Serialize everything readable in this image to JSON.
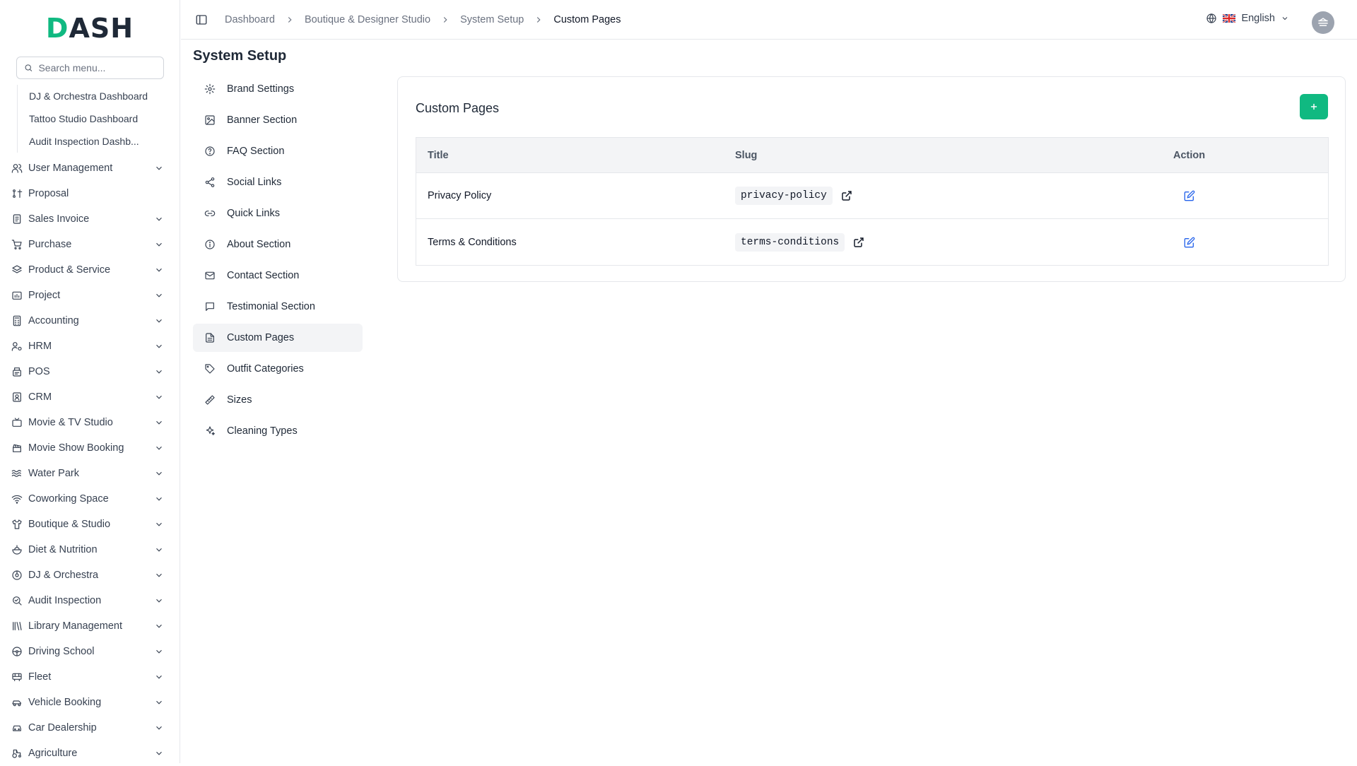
{
  "app": {
    "logo_text": "DASH"
  },
  "sidebar": {
    "search_placeholder": "Search menu...",
    "sub_items": [
      "DJ & Orchestra Dashboard",
      "Tattoo Studio Dashboard",
      "Audit Inspection Dashb..."
    ],
    "items": [
      {
        "label": "User Management",
        "icon": "users-icon",
        "chevron": true
      },
      {
        "label": "Proposal",
        "icon": "proposal-icon",
        "chevron": false
      },
      {
        "label": "Sales Invoice",
        "icon": "invoice-icon",
        "chevron": true
      },
      {
        "label": "Purchase",
        "icon": "cart-icon",
        "chevron": true
      },
      {
        "label": "Product & Service",
        "icon": "layers-icon",
        "chevron": true
      },
      {
        "label": "Project",
        "icon": "project-icon",
        "chevron": true
      },
      {
        "label": "Accounting",
        "icon": "calculator-icon",
        "chevron": true
      },
      {
        "label": "HRM",
        "icon": "hrm-icon",
        "chevron": true
      },
      {
        "label": "POS",
        "icon": "pos-icon",
        "chevron": true
      },
      {
        "label": "CRM",
        "icon": "crm-icon",
        "chevron": true
      },
      {
        "label": "Movie & TV Studio",
        "icon": "tv-icon",
        "chevron": true
      },
      {
        "label": "Movie Show Booking",
        "icon": "clapper-icon",
        "chevron": true
      },
      {
        "label": "Water Park",
        "icon": "waves-icon",
        "chevron": true
      },
      {
        "label": "Coworking Space",
        "icon": "wifi-icon",
        "chevron": true
      },
      {
        "label": "Boutique & Studio",
        "icon": "shirt-icon",
        "chevron": true
      },
      {
        "label": "Diet & Nutrition",
        "icon": "salad-icon",
        "chevron": true
      },
      {
        "label": "DJ & Orchestra",
        "icon": "music-icon",
        "chevron": true
      },
      {
        "label": "Audit Inspection",
        "icon": "inspect-icon",
        "chevron": true
      },
      {
        "label": "Library Management",
        "icon": "library-icon",
        "chevron": true
      },
      {
        "label": "Driving School",
        "icon": "steering-icon",
        "chevron": true
      },
      {
        "label": "Fleet",
        "icon": "bus-icon",
        "chevron": true
      },
      {
        "label": "Vehicle Booking",
        "icon": "car-icon",
        "chevron": true
      },
      {
        "label": "Car Dealership",
        "icon": "car-front-icon",
        "chevron": true
      },
      {
        "label": "Agriculture",
        "icon": "tractor-icon",
        "chevron": true
      }
    ]
  },
  "header": {
    "breadcrumbs": [
      "Dashboard",
      "Boutique & Designer Studio",
      "System Setup",
      "Custom Pages"
    ],
    "language": "English"
  },
  "main": {
    "title": "System Setup",
    "setup_menu": [
      {
        "label": "Brand Settings",
        "icon": "gear-icon"
      },
      {
        "label": "Banner Section",
        "icon": "image-icon"
      },
      {
        "label": "FAQ Section",
        "icon": "help-circle-icon"
      },
      {
        "label": "Social Links",
        "icon": "share-icon"
      },
      {
        "label": "Quick Links",
        "icon": "link-icon"
      },
      {
        "label": "About Section",
        "icon": "info-icon"
      },
      {
        "label": "Contact Section",
        "icon": "mail-icon"
      },
      {
        "label": "Testimonial Section",
        "icon": "message-icon"
      },
      {
        "label": "Custom Pages",
        "icon": "file-icon",
        "active": true
      },
      {
        "label": "Outfit Categories",
        "icon": "tag-icon"
      },
      {
        "label": "Sizes",
        "icon": "ruler-icon"
      },
      {
        "label": "Cleaning Types",
        "icon": "sparkles-icon"
      }
    ],
    "card": {
      "title": "Custom Pages",
      "columns": [
        "Title",
        "Slug",
        "Action"
      ],
      "rows": [
        {
          "title": "Privacy Policy",
          "slug": "privacy-policy"
        },
        {
          "title": "Terms & Conditions",
          "slug": "terms-conditions"
        }
      ]
    }
  },
  "colors": {
    "accent": "#10b981",
    "edit": "#2563eb"
  }
}
